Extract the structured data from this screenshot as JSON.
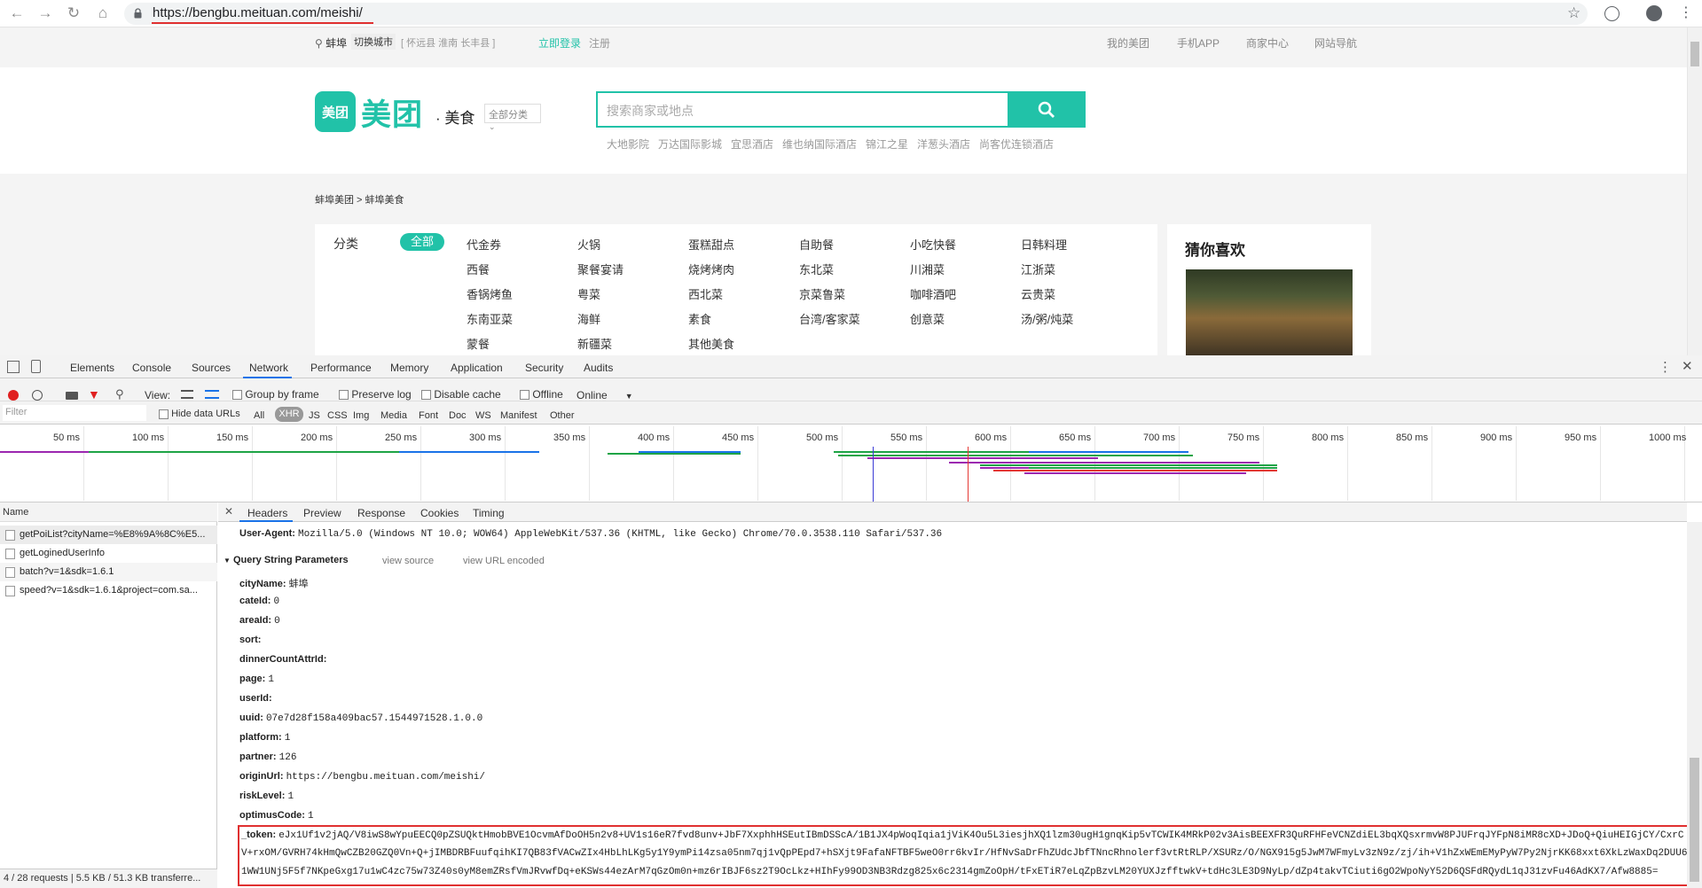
{
  "browser": {
    "url": "https://bengbu.meituan.com/meishi/"
  },
  "site": {
    "city": "蚌埠",
    "switch_city": "切换城市",
    "nearby_cities": "[ 怀远县  淮南  长丰县 ]",
    "login": "立即登录",
    "register": "注册",
    "top_links": [
      "我的美团",
      "手机APP",
      "商家中心",
      "网站导航"
    ],
    "logo_icon_text": "美团",
    "logo_text": "美团",
    "logo_sub": "· 美食",
    "category_select": "全部分类",
    "search_placeholder": "搜索商家或地点",
    "hot_searches": [
      "大地影院",
      "万达国际影城",
      "宜思酒店",
      "维也纳国际酒店",
      "锦江之星",
      "洋葱头酒店",
      "尚客优连锁酒店"
    ],
    "breadcrumb": "蚌埠美团 > 蚌埠美食",
    "category_label": "分类",
    "category_all": "全部",
    "categories": [
      [
        "代金券",
        "火锅",
        "蛋糕甜点",
        "自助餐",
        "小吃快餐",
        "日韩料理"
      ],
      [
        "西餐",
        "聚餐宴请",
        "烧烤烤肉",
        "东北菜",
        "川湘菜",
        "江浙菜"
      ],
      [
        "香锅烤鱼",
        "粤菜",
        "西北菜",
        "京菜鲁菜",
        "咖啡酒吧",
        "云贵菜"
      ],
      [
        "东南亚菜",
        "海鲜",
        "素食",
        "台湾/客家菜",
        "创意菜",
        "汤/粥/炖菜"
      ],
      [
        "蒙餐",
        "新疆菜",
        "其他美食"
      ]
    ],
    "guess_title": "猜你喜欢"
  },
  "devtools": {
    "tabs": [
      "Elements",
      "Console",
      "Sources",
      "Network",
      "Performance",
      "Memory",
      "Application",
      "Security",
      "Audits"
    ],
    "active_tab": "Network",
    "toolbar": {
      "view": "View:",
      "group_by_frame": "Group by frame",
      "preserve_log": "Preserve log",
      "disable_cache": "Disable cache",
      "offline": "Offline",
      "throttle": "Online"
    },
    "filter": {
      "placeholder": "Filter",
      "hide_data_urls": "Hide data URLs",
      "types": [
        "All",
        "XHR",
        "JS",
        "CSS",
        "Img",
        "Media",
        "Font",
        "Doc",
        "WS",
        "Manifest",
        "Other"
      ],
      "active_type": "XHR"
    },
    "timeline_labels": [
      "50 ms",
      "100 ms",
      "150 ms",
      "200 ms",
      "250 ms",
      "300 ms",
      "350 ms",
      "400 ms",
      "450 ms",
      "500 ms",
      "550 ms",
      "600 ms",
      "650 ms",
      "700 ms",
      "750 ms",
      "800 ms",
      "850 ms",
      "900 ms",
      "950 ms",
      "1000 ms"
    ],
    "name_header": "Name",
    "requests": [
      "getPoiList?cityName=%E8%9A%8C%E5...",
      "getLoginedUserInfo",
      "batch?v=1&sdk=1.6.1",
      "speed?v=1&sdk=1.6.1&project=com.sa..."
    ],
    "status_bar": "4 / 28 requests  |  5.5 KB / 51.3 KB transferre...",
    "detail_tabs": [
      "Headers",
      "Preview",
      "Response",
      "Cookies",
      "Timing"
    ],
    "user_agent_key": "User-Agent:",
    "user_agent_value": "Mozilla/5.0 (Windows NT 10.0; WOW64) AppleWebKit/537.36 (KHTML, like Gecko) Chrome/70.0.3538.110 Safari/537.36",
    "qs_section": "Query String Parameters",
    "view_source": "view source",
    "view_url_encoded": "view URL encoded",
    "params": [
      {
        "key": "cityName:",
        "value": "蚌埠"
      },
      {
        "key": "cateId:",
        "value": "0"
      },
      {
        "key": "areaId:",
        "value": "0"
      },
      {
        "key": "sort:",
        "value": ""
      },
      {
        "key": "dinnerCountAttrId:",
        "value": ""
      },
      {
        "key": "page:",
        "value": "1"
      },
      {
        "key": "userId:",
        "value": ""
      },
      {
        "key": "uuid:",
        "value": "07e7d28f158a409bac57.1544971528.1.0.0"
      },
      {
        "key": "platform:",
        "value": "1"
      },
      {
        "key": "partner:",
        "value": "126"
      },
      {
        "key": "originUrl:",
        "value": "https://bengbu.meituan.com/meishi/"
      },
      {
        "key": "riskLevel:",
        "value": "1"
      },
      {
        "key": "optimusCode:",
        "value": "1"
      }
    ],
    "token_key": "_token:",
    "token_lines": [
      "eJx1Uf1v2jAQ/V8iwS8wYpuEECQ0pZSUQktHmobBVE1OcvmAfDoOH5n2v8+UV1s16eR7fvd8unv+JbF7XxphhHSEutIBmDSScA/1B1JX4pWoqIqia1jViK4Ou5L3iesjhXQ1lzm30ugH1gnqKip5vTCWIK4MRkP02v3AisBEEXFR3QuRFHFeVCNZdiEL3bqXQsxrmvW8PJUFrqJYFpN8iMR8cXD+JDoQ+QiuHEIGjCY/CxrC",
      "V+rxOM/GVRH74kHmQwCZB20GZQ0Vn+Q+jIMBDRBFuufqihKI7QB83fVACwZIx4HbLhLKg5y1Y9ymPi14zsa05nm7qj1vQpPEpd7+hSXjt9FafaNFTBF5weO0rr6kvIr/HfNvSaDrFhZUdcJbfTNncRhnolerf3vtRtRLP/XSURz/O/NGX915g5JwM7WFmyLv3zN9z/zj/ih+V1hZxWEmEMyPyW7Py2NjrKK68xxt6XkLzWaxDq2DUU6",
      "1WW1UNj5F5f7NKpeGxg17u1wC4zc75w73Z40s0yM8emZRsfVmJRvwfDq+eKSWs44ezArM7qGzOm0n+mz6rIBJF6sz2T9OcLkz+HIhFy99OD3NB3Rdzg825x6c2314gmZoOpH/tFxETiR7eLqZpBzvLM20YUXJzfftwkV+tdHc3LE3D9NyLp/dZp4takvTCiuti6gO2WpoNyY52D6QSFdRQydL1qJ31zvFu46AdKX7/Afw8885="
    ]
  }
}
